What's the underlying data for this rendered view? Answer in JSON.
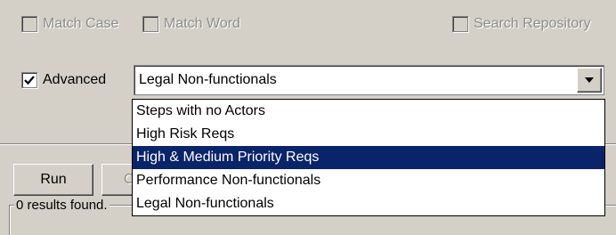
{
  "options": {
    "match_case": {
      "label": "Match Case",
      "checked": false,
      "enabled": false
    },
    "match_word": {
      "label": "Match Word",
      "checked": false,
      "enabled": false
    },
    "search_repository": {
      "label": "Search Repository",
      "checked": false,
      "enabled": false
    },
    "advanced": {
      "label": "Advanced",
      "checked": true,
      "enabled": true
    }
  },
  "query_select": {
    "value": "Legal Non-functionals",
    "options": [
      "Steps with no Actors",
      "High Risk Reqs",
      "High & Medium Priority Reqs",
      "Performance Non-functionals",
      "Legal Non-functionals"
    ],
    "highlighted": "High & Medium Priority Reqs"
  },
  "buttons": {
    "run": "Run",
    "second_partial": "C"
  },
  "results": {
    "summary": "0 results found."
  },
  "colors": {
    "face": "#d4d0c8",
    "highlight": "#0a246a",
    "disabled_text": "#8f8d88"
  }
}
